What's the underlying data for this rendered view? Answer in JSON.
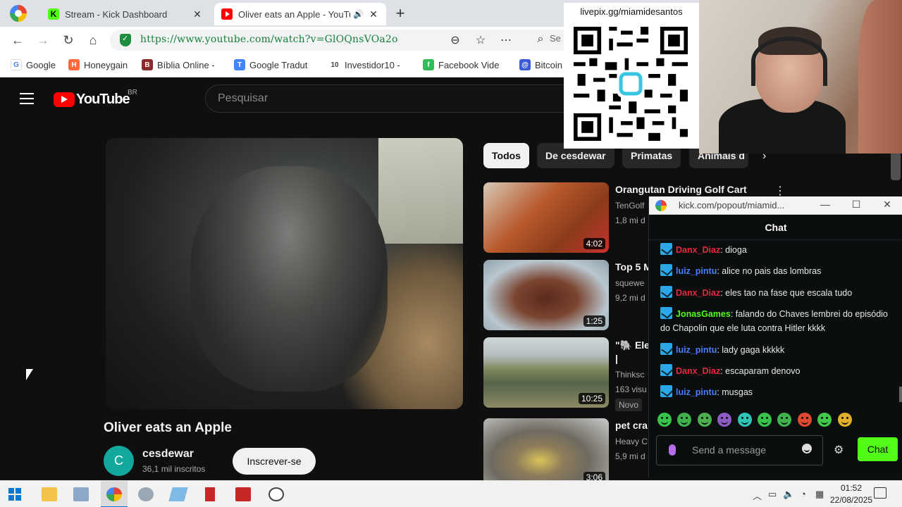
{
  "browser": {
    "tabs": [
      {
        "title": "Stream - Kick Dashboard",
        "close": "✕"
      },
      {
        "title": "Oliver eats an Apple - YouTube",
        "close": "✕"
      }
    ],
    "new_tab": "+",
    "url": "https://www.youtube.com/watch?v=GlOQnsVOa2o",
    "search_partial": "Se",
    "bookmarks": [
      {
        "label": "Google",
        "color": "#4285f4",
        "glyph": "G"
      },
      {
        "label": "Honeygain",
        "color": "#ff6a3d",
        "glyph": "H"
      },
      {
        "label": "Bíblia Online -",
        "color": "#8b2a2a",
        "glyph": "B"
      },
      {
        "label": "Google Tradut",
        "color": "#4285f4",
        "glyph": "T"
      },
      {
        "label": "Investidor10 -",
        "color": "#444444",
        "glyph": "10"
      },
      {
        "label": "Facebook Vide",
        "color": "#2ebd59",
        "glyph": "f"
      },
      {
        "label": "Bitcoin",
        "color": "#3b5bdb",
        "glyph": "@"
      }
    ]
  },
  "youtube": {
    "logo_text": "YouTube",
    "country": "BR",
    "search_placeholder": "Pesquisar",
    "video_title": "Oliver eats an Apple",
    "channel": {
      "avatar_letter": "C",
      "name": "cesdewar",
      "subscribers": "36,1 mil inscritos",
      "subscribe_label": "Inscrever-se"
    },
    "chips": [
      "Todos",
      "De cesdewar",
      "Primatas",
      "Animais d"
    ],
    "recommendations": [
      {
        "title": "Orangutan Driving Golf Cart",
        "channel": "TenGolf",
        "views": "1,8 mi d",
        "duration": "4:02",
        "badge": ""
      },
      {
        "title": "Top 5 M",
        "channel": "squewe",
        "views": "9,2 mi d",
        "duration": "1:25",
        "badge": ""
      },
      {
        "title": "\"🐘 Ele | Gentle",
        "channel": "Thinksc",
        "views": "163 visu",
        "duration": "10:25",
        "badge": "Novo"
      },
      {
        "title": "pet cra",
        "channel": "Heavy C",
        "views": "5,9 mi d",
        "duration": "3:06",
        "badge": ""
      }
    ]
  },
  "overlay": {
    "qr_label": "livepix.gg/miamidesantos"
  },
  "chat_popout": {
    "window_url": "kick.com/popout/miamid...",
    "header": "Chat",
    "messages": [
      {
        "user": "Danx_Diaz",
        "color": "#e8273f",
        "text": ": dioga"
      },
      {
        "user": "luiz_pintu",
        "color": "#4a7dff",
        "text": ": alice no pais das lombras"
      },
      {
        "user": "Danx_Diaz",
        "color": "#e8273f",
        "text": ": eles tao na fase que escala tudo"
      },
      {
        "user": "JonasGames",
        "color": "#53fc18",
        "text": ": falando do Chaves lembrei do episódio do Chapolin que ele luta contra Hitler kkkk"
      },
      {
        "user": "luiz_pintu",
        "color": "#4a7dff",
        "text": ": lady gaga kkkkk"
      },
      {
        "user": "Danx_Diaz",
        "color": "#e8273f",
        "text": ": escaparam denovo"
      },
      {
        "user": "luiz_pintu",
        "color": "#4a7dff",
        "text": ": musgas"
      }
    ],
    "input_placeholder": "Send a message",
    "send_label": "Chat"
  },
  "taskbar": {
    "time": "01:52",
    "date": "22/08/2025"
  }
}
